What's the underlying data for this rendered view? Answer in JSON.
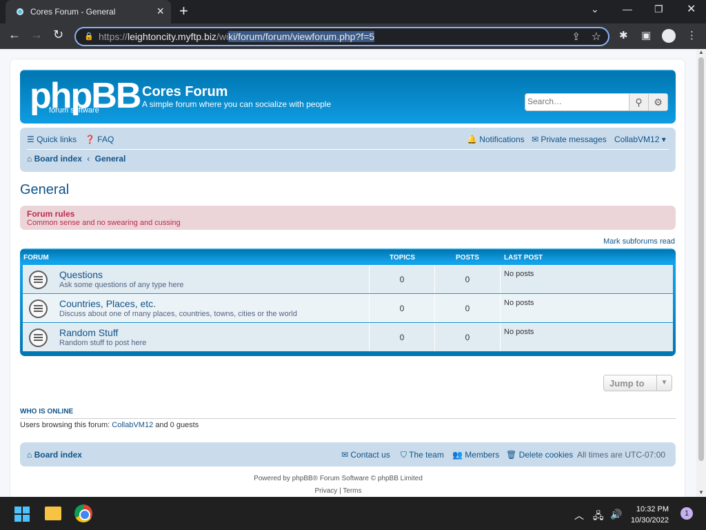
{
  "browser": {
    "tab_title": "Cores Forum - General",
    "url_scheme": "https://",
    "url_domain": "leightoncity.myftp.biz",
    "url_path_pre": "/wi",
    "url_path_sel": "ki/forum/forum/viewforum.php?f=5"
  },
  "header": {
    "logo_text": "phpBB",
    "logo_sub": "forum  software",
    "site_name": "Cores Forum",
    "site_desc": "A simple forum where you can socialize with people",
    "search_placeholder": "Search…"
  },
  "navbar": {
    "quick_links": "Quick links",
    "faq": "FAQ",
    "notifications": "Notifications",
    "private_messages": "Private messages",
    "user": "CollabVM12",
    "board_index": "Board index",
    "crumb_sep": "‹",
    "crumb_current": "General"
  },
  "page": {
    "title": "General",
    "rules_title": "Forum rules",
    "rules_text": "Common sense and no swearing and cussing",
    "mark_read": "Mark subforums read"
  },
  "table": {
    "headers": {
      "forum": "FORUM",
      "topics": "TOPICS",
      "posts": "POSTS",
      "last_post": "LAST POST"
    },
    "rows": [
      {
        "name": "Questions",
        "desc": "Ask some questions of any type here",
        "topics": "0",
        "posts": "0",
        "last": "No posts"
      },
      {
        "name": "Countries, Places, etc.",
        "desc": "Discuss about one of many places, countries, towns, cities or the world",
        "topics": "0",
        "posts": "0",
        "last": "No posts"
      },
      {
        "name": "Random Stuff",
        "desc": "Random stuff to post here",
        "topics": "0",
        "posts": "0",
        "last": "No posts"
      }
    ]
  },
  "jump": {
    "label": "Jump to"
  },
  "online": {
    "heading": "WHO IS ONLINE",
    "prefix": "Users browsing this forum: ",
    "user": "CollabVM12",
    "suffix": " and 0 guests"
  },
  "footer": {
    "board_index": "Board index",
    "contact": "Contact us",
    "team": "The team",
    "members": "Members",
    "cookies": "Delete cookies",
    "timezone": "All times are UTC-07:00",
    "powered": "Powered by phpBB® Forum Software © phpBB Limited",
    "privacy": "Privacy",
    "links_sep": "|",
    "terms": "Terms"
  },
  "taskbar": {
    "time": "10:32 PM",
    "date": "10/30/2022",
    "notif_count": "1"
  }
}
